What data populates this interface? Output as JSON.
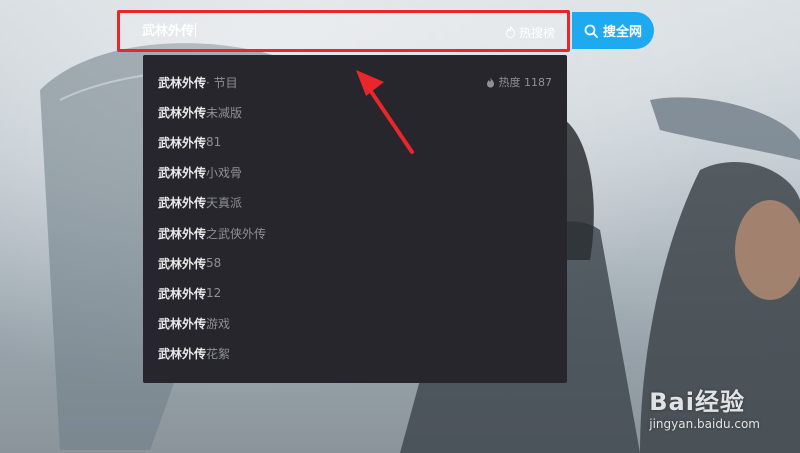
{
  "search": {
    "query": "武林外传",
    "hot_label": "热搜榜",
    "button_label": "搜全网"
  },
  "suggestions": [
    {
      "keyword": "武林外传",
      "rest": " · 节目",
      "heat": "热度 1187"
    },
    {
      "keyword": "武林外传",
      "rest": "未减版"
    },
    {
      "keyword": "武林外传",
      "rest": "81"
    },
    {
      "keyword": "武林外传",
      "rest": "小戏骨"
    },
    {
      "keyword": "武林外传",
      "rest": "天真派"
    },
    {
      "keyword": "武林外传",
      "rest": "之武侠外传"
    },
    {
      "keyword": "武林外传",
      "rest": "58"
    },
    {
      "keyword": "武林外传",
      "rest": "12"
    },
    {
      "keyword": "武林外传",
      "rest": "游戏"
    },
    {
      "keyword": "武林外传",
      "rest": "花絮"
    }
  ],
  "watermark": {
    "logo_text": "Bai经验",
    "url": "jingyan.baidu.com"
  },
  "colors": {
    "highlight_border": "#e8262b",
    "search_button": "#1eaaf1",
    "dropdown_bg": "#26262c"
  }
}
